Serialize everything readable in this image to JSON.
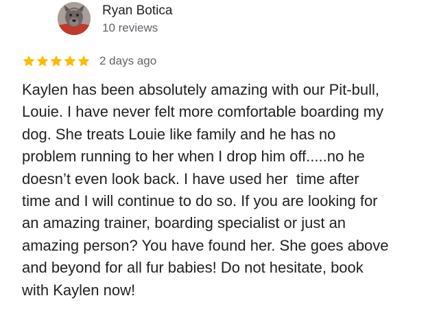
{
  "reviewer": {
    "name": "Ryan Botica",
    "meta": "10 reviews",
    "avatar_icon": "dog-avatar"
  },
  "rating": {
    "stars": 5,
    "max": 5,
    "star_color": "#fbbc04",
    "date": "2 days ago"
  },
  "review": {
    "lines": [
      "Kaylen has been absolutely amazing with our Pit-bull,",
      "Louie. I have never felt more comfortable boarding my",
      "dog. She treats Louie like family and he has no",
      "problem running to her when I drop him off.....no he",
      "doesn’t even look back. I have used her  time after",
      "time and I will continue to do so. If you are looking for",
      "an amazing trainer, boarding specialist or just an",
      "amazing person? You have found her. She goes above",
      "and beyond for all fur babies! Do not hesitate, book",
      "with Kaylen now!"
    ]
  }
}
